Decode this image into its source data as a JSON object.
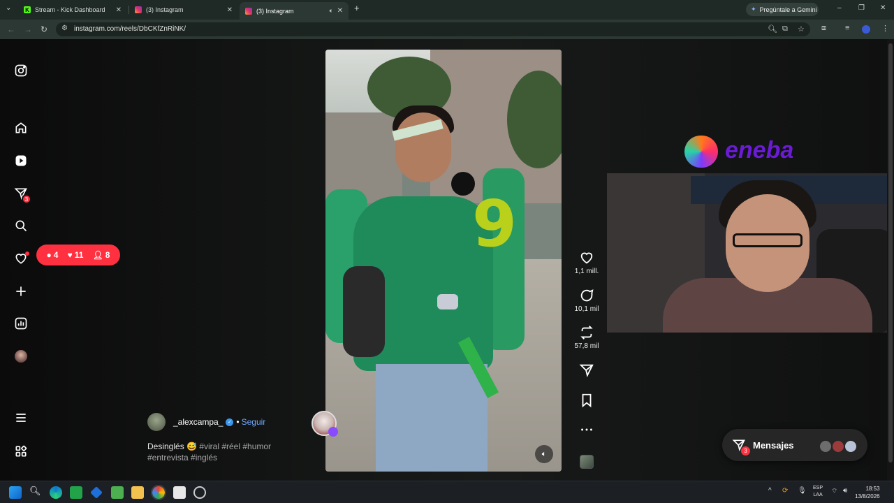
{
  "browser": {
    "tabs": [
      {
        "title": "Stream - Kick Dashboard",
        "favicon_label": "K",
        "favicon_color": "#53fc18",
        "active": false
      },
      {
        "title": "(3) Instagram",
        "favicon_label": "",
        "favicon_color": "#e1306c",
        "active": false
      },
      {
        "title": "(3) Instagram",
        "favicon_label": "",
        "favicon_color": "#e1306c",
        "active": true
      }
    ],
    "new_tab": "+",
    "gemini_label": "Pregúntale a Gemini",
    "url": "instagram.com/reels/DbCKfZnRiNK/"
  },
  "sidebar": {
    "items": [
      {
        "name": "instagram-logo-icon"
      },
      {
        "name": "home-icon"
      },
      {
        "name": "reels-icon"
      },
      {
        "name": "messages-icon"
      },
      {
        "name": "search-icon"
      },
      {
        "name": "notifications-icon"
      },
      {
        "name": "create-icon"
      },
      {
        "name": "dashboard-icon"
      },
      {
        "name": "profile-avatar"
      },
      {
        "name": "more-menu-icon"
      },
      {
        "name": "also-from-meta-icon"
      }
    ],
    "messages_badge": "3",
    "notif_pill": {
      "comments": "4",
      "likes": "11",
      "follows": "8"
    }
  },
  "reel": {
    "overlay_number": "9",
    "author": "_alexcampa_",
    "separator": "•",
    "follow_label": "Seguir",
    "caption_text": "Desinglés 😅",
    "caption_tags": "#viral #réel #humor #entrevista #inglés",
    "likes": "1,1 mill.",
    "comments": "10,1 mil",
    "reposts": "57,8 mil"
  },
  "overlay": {
    "sponsor": "eneba",
    "sponsor_color": "#6a1bd4"
  },
  "messages": {
    "label": "Mensajes",
    "count": "3"
  },
  "taskbar": {
    "lang_top": "ESP",
    "lang_bottom": "LAA",
    "time": "18:53",
    "date": "13/8/2026"
  }
}
